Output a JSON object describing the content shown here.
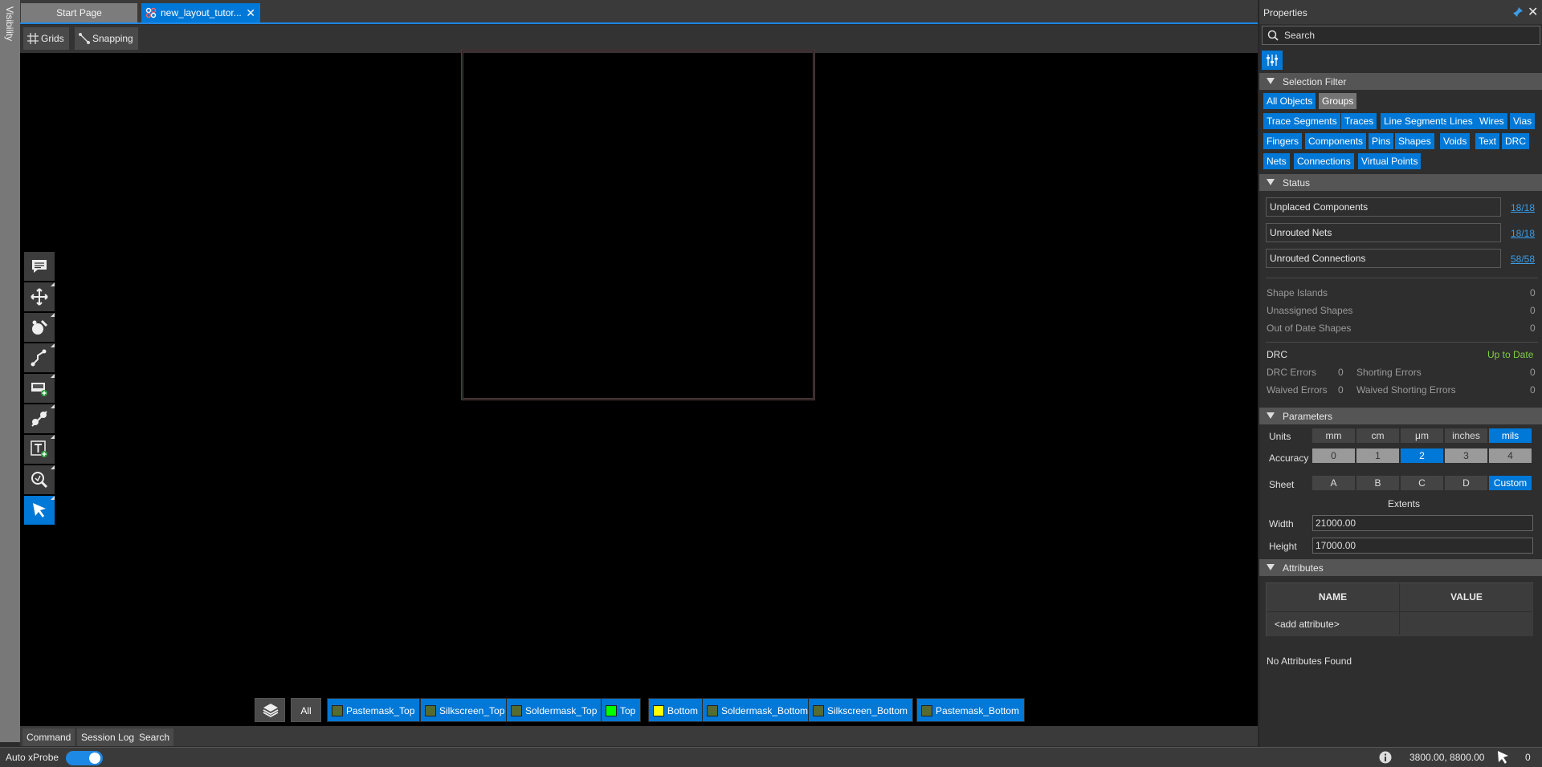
{
  "visibility_label": "Visibility",
  "tabs": {
    "start": "Start Page",
    "active": "new_layout_tutor...",
    "close": "✕"
  },
  "toolbar": {
    "grids": "Grids",
    "snapping": "Snapping"
  },
  "tools": [
    "comment-tool",
    "move-tool",
    "route-tool",
    "trace-tool",
    "add-shape-tool",
    "connect-tool",
    "add-text-tool",
    "zoom-tool",
    "select-tool"
  ],
  "layers": {
    "all": "All",
    "items": [
      {
        "name": "Pastemask_Top",
        "color": "#556b2f"
      },
      {
        "name": "Silkscreen_Top",
        "color": "#556b2f"
      },
      {
        "name": "Soldermask_Top",
        "color": "#556b2f"
      },
      {
        "name": "Top",
        "color": "#00ff00"
      },
      {
        "name": "Bottom",
        "color": "#ffff00"
      },
      {
        "name": "Soldermask_Bottom",
        "color": "#556b2f"
      },
      {
        "name": "Silkscreen_Bottom",
        "color": "#556b2f"
      },
      {
        "name": "Pastemask_Bottom",
        "color": "#556b2f"
      }
    ]
  },
  "bottom_tabs": [
    "Command",
    "Session Log",
    "Search"
  ],
  "statusbar": {
    "auto_xprobe": "Auto xProbe",
    "coords": "3800.00, 8800.00",
    "count": "0"
  },
  "properties": {
    "title": "Properties",
    "search_placeholder": "Search",
    "selection_filter": {
      "label": "Selection Filter",
      "chips": [
        {
          "label": "All Objects",
          "on": true
        },
        {
          "label": "Groups",
          "on": false
        },
        {
          "label": "Trace Segments",
          "on": true
        },
        {
          "label": "Traces",
          "on": true
        },
        {
          "label": "Line Segments",
          "on": true
        },
        {
          "label": "Lines",
          "on": true
        },
        {
          "label": "Wires",
          "on": true
        },
        {
          "label": "Vias",
          "on": true
        },
        {
          "label": "Fingers",
          "on": true
        },
        {
          "label": "Components",
          "on": true
        },
        {
          "label": "Pins",
          "on": true
        },
        {
          "label": "Shapes",
          "on": true
        },
        {
          "label": "Voids",
          "on": true
        },
        {
          "label": "Text",
          "on": true
        },
        {
          "label": "DRC",
          "on": true
        },
        {
          "label": "Nets",
          "on": true
        },
        {
          "label": "Connections",
          "on": true
        },
        {
          "label": "Virtual Points",
          "on": true
        }
      ]
    },
    "status": {
      "label": "Status",
      "rows": [
        {
          "label": "Unplaced Components",
          "value": "18/18"
        },
        {
          "label": "Unrouted Nets",
          "value": "18/18"
        },
        {
          "label": "Unrouted Connections",
          "value": "58/58"
        }
      ],
      "shapes": [
        {
          "label": "Shape Islands",
          "value": "0"
        },
        {
          "label": "Unassigned Shapes",
          "value": "0"
        },
        {
          "label": "Out of Date Shapes",
          "value": "0"
        }
      ],
      "drc_label": "DRC",
      "drc_state": "Up to Date",
      "drc_errors_label": "DRC Errors",
      "drc_errors": "0",
      "shorting_errors_label": "Shorting Errors",
      "shorting_errors": "0",
      "waived_errors_label": "Waived Errors",
      "waived_errors": "0",
      "waived_shorting_label": "Waived Shorting Errors",
      "waived_shorting": "0"
    },
    "parameters": {
      "label": "Parameters",
      "units_label": "Units",
      "units": [
        "mm",
        "cm",
        "μm",
        "inches",
        "mils"
      ],
      "units_selected": "mils",
      "accuracy_label": "Accuracy",
      "accuracy": [
        "0",
        "1",
        "2",
        "3",
        "4"
      ],
      "accuracy_selected": "2",
      "sheet_label": "Sheet",
      "sheets": [
        "A",
        "B",
        "C",
        "D",
        "Custom"
      ],
      "sheet_selected": "Custom",
      "extents_label": "Extents",
      "width_label": "Width",
      "width": "21000.00",
      "height_label": "Height",
      "height": "17000.00"
    },
    "attributes": {
      "label": "Attributes",
      "col_name": "NAME",
      "col_value": "VALUE",
      "add": "<add attribute>",
      "empty": "No Attributes Found"
    }
  },
  "colors": {
    "accent": "#0078d7",
    "drc_ok": "#7fcf3f",
    "link": "#3b9de8"
  }
}
